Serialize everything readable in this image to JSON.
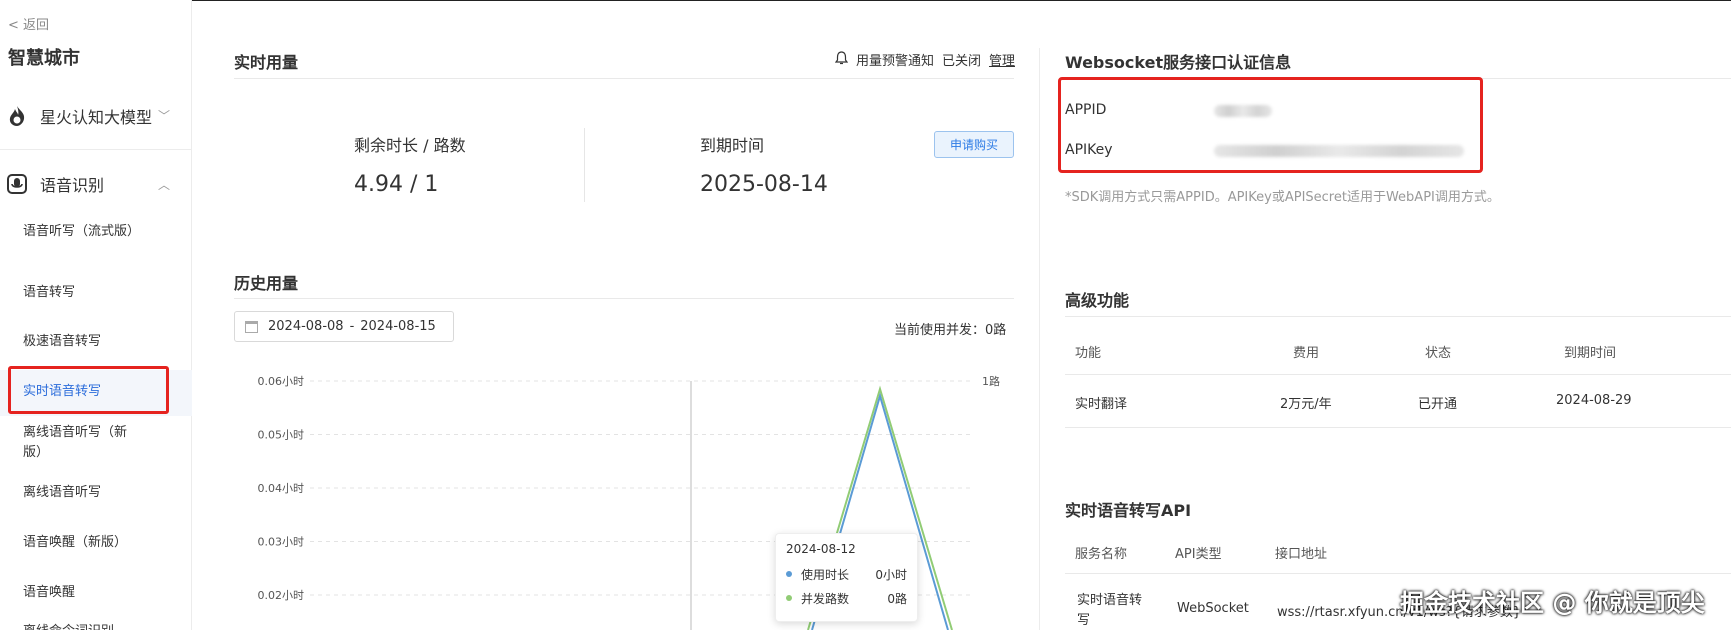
{
  "sidebar": {
    "back_label": "< 返回",
    "app_name": "智慧城市",
    "groups": [
      {
        "label": "星火认知大模型"
      },
      {
        "label": "语音识别"
      }
    ],
    "items": [
      {
        "label": "语音听写（流式版）"
      },
      {
        "label": "语音转写"
      },
      {
        "label": "极速语音转写"
      },
      {
        "label": "实时语音转写"
      },
      {
        "label": "离线语音听写（新版）"
      },
      {
        "label": "离线语音听写"
      },
      {
        "label": "语音唤醒（新版）"
      },
      {
        "label": "语音唤醒"
      },
      {
        "label": "离线命令词识别"
      }
    ],
    "active_item": "实时语音转写"
  },
  "realtime_usage": {
    "title": "实时用量",
    "alert_label": "用量预警通知",
    "alert_status": "已关闭",
    "manage_label": "管理",
    "remaining_label": "剩余时长 / 路数",
    "remaining_value": "4.94 / 1",
    "expiry_label": "到期时间",
    "expiry_value": "2025-08-14",
    "apply_button": "申请购买"
  },
  "history_usage": {
    "title": "历史用量",
    "date_from": "2024-08-08",
    "date_to": "2024-08-15",
    "concurrent_label": "当前使用并发：0路"
  },
  "chart_data": {
    "type": "line",
    "y_ticks_left": [
      "0.06小时",
      "0.05小时",
      "0.04小时",
      "0.03小时",
      "0.02小时"
    ],
    "y_tick_right": "1路",
    "ylim": [
      0,
      0.06
    ],
    "series": [
      {
        "name": "使用时长",
        "color": "#5b9bd5"
      },
      {
        "name": "并发路数",
        "color": "#91cc75"
      }
    ],
    "tooltip": {
      "date": "2024-08-12",
      "rows": [
        {
          "name": "使用时长",
          "value": "0小时",
          "color": "#5b9bd5"
        },
        {
          "name": "并发路数",
          "value": "0路",
          "color": "#91cc75"
        }
      ]
    }
  },
  "websocket_auth": {
    "title": "Websocket服务接口认证信息",
    "appid_label": "APPID",
    "apikey_label": "APIKey",
    "note": "*SDK调用方式只需APPID。APIKey或APISecret适用于WebAPI调用方式。"
  },
  "advanced": {
    "title": "高级功能",
    "headers": [
      "功能",
      "费用",
      "状态",
      "到期时间"
    ],
    "rows": [
      [
        "实时翻译",
        "2万元/年",
        "已开通",
        "2024-08-29"
      ]
    ]
  },
  "api_section": {
    "title": "实时语音转写API",
    "headers": [
      "服务名称",
      "API类型",
      "接口地址"
    ],
    "rows": [
      [
        "实时语音转写",
        "WebSocket",
        "wss://rtasr.xfyun.cn/v1/ws?{请求参数}"
      ]
    ]
  },
  "watermark": "掘金技术社区 @ 你就是顶尖"
}
